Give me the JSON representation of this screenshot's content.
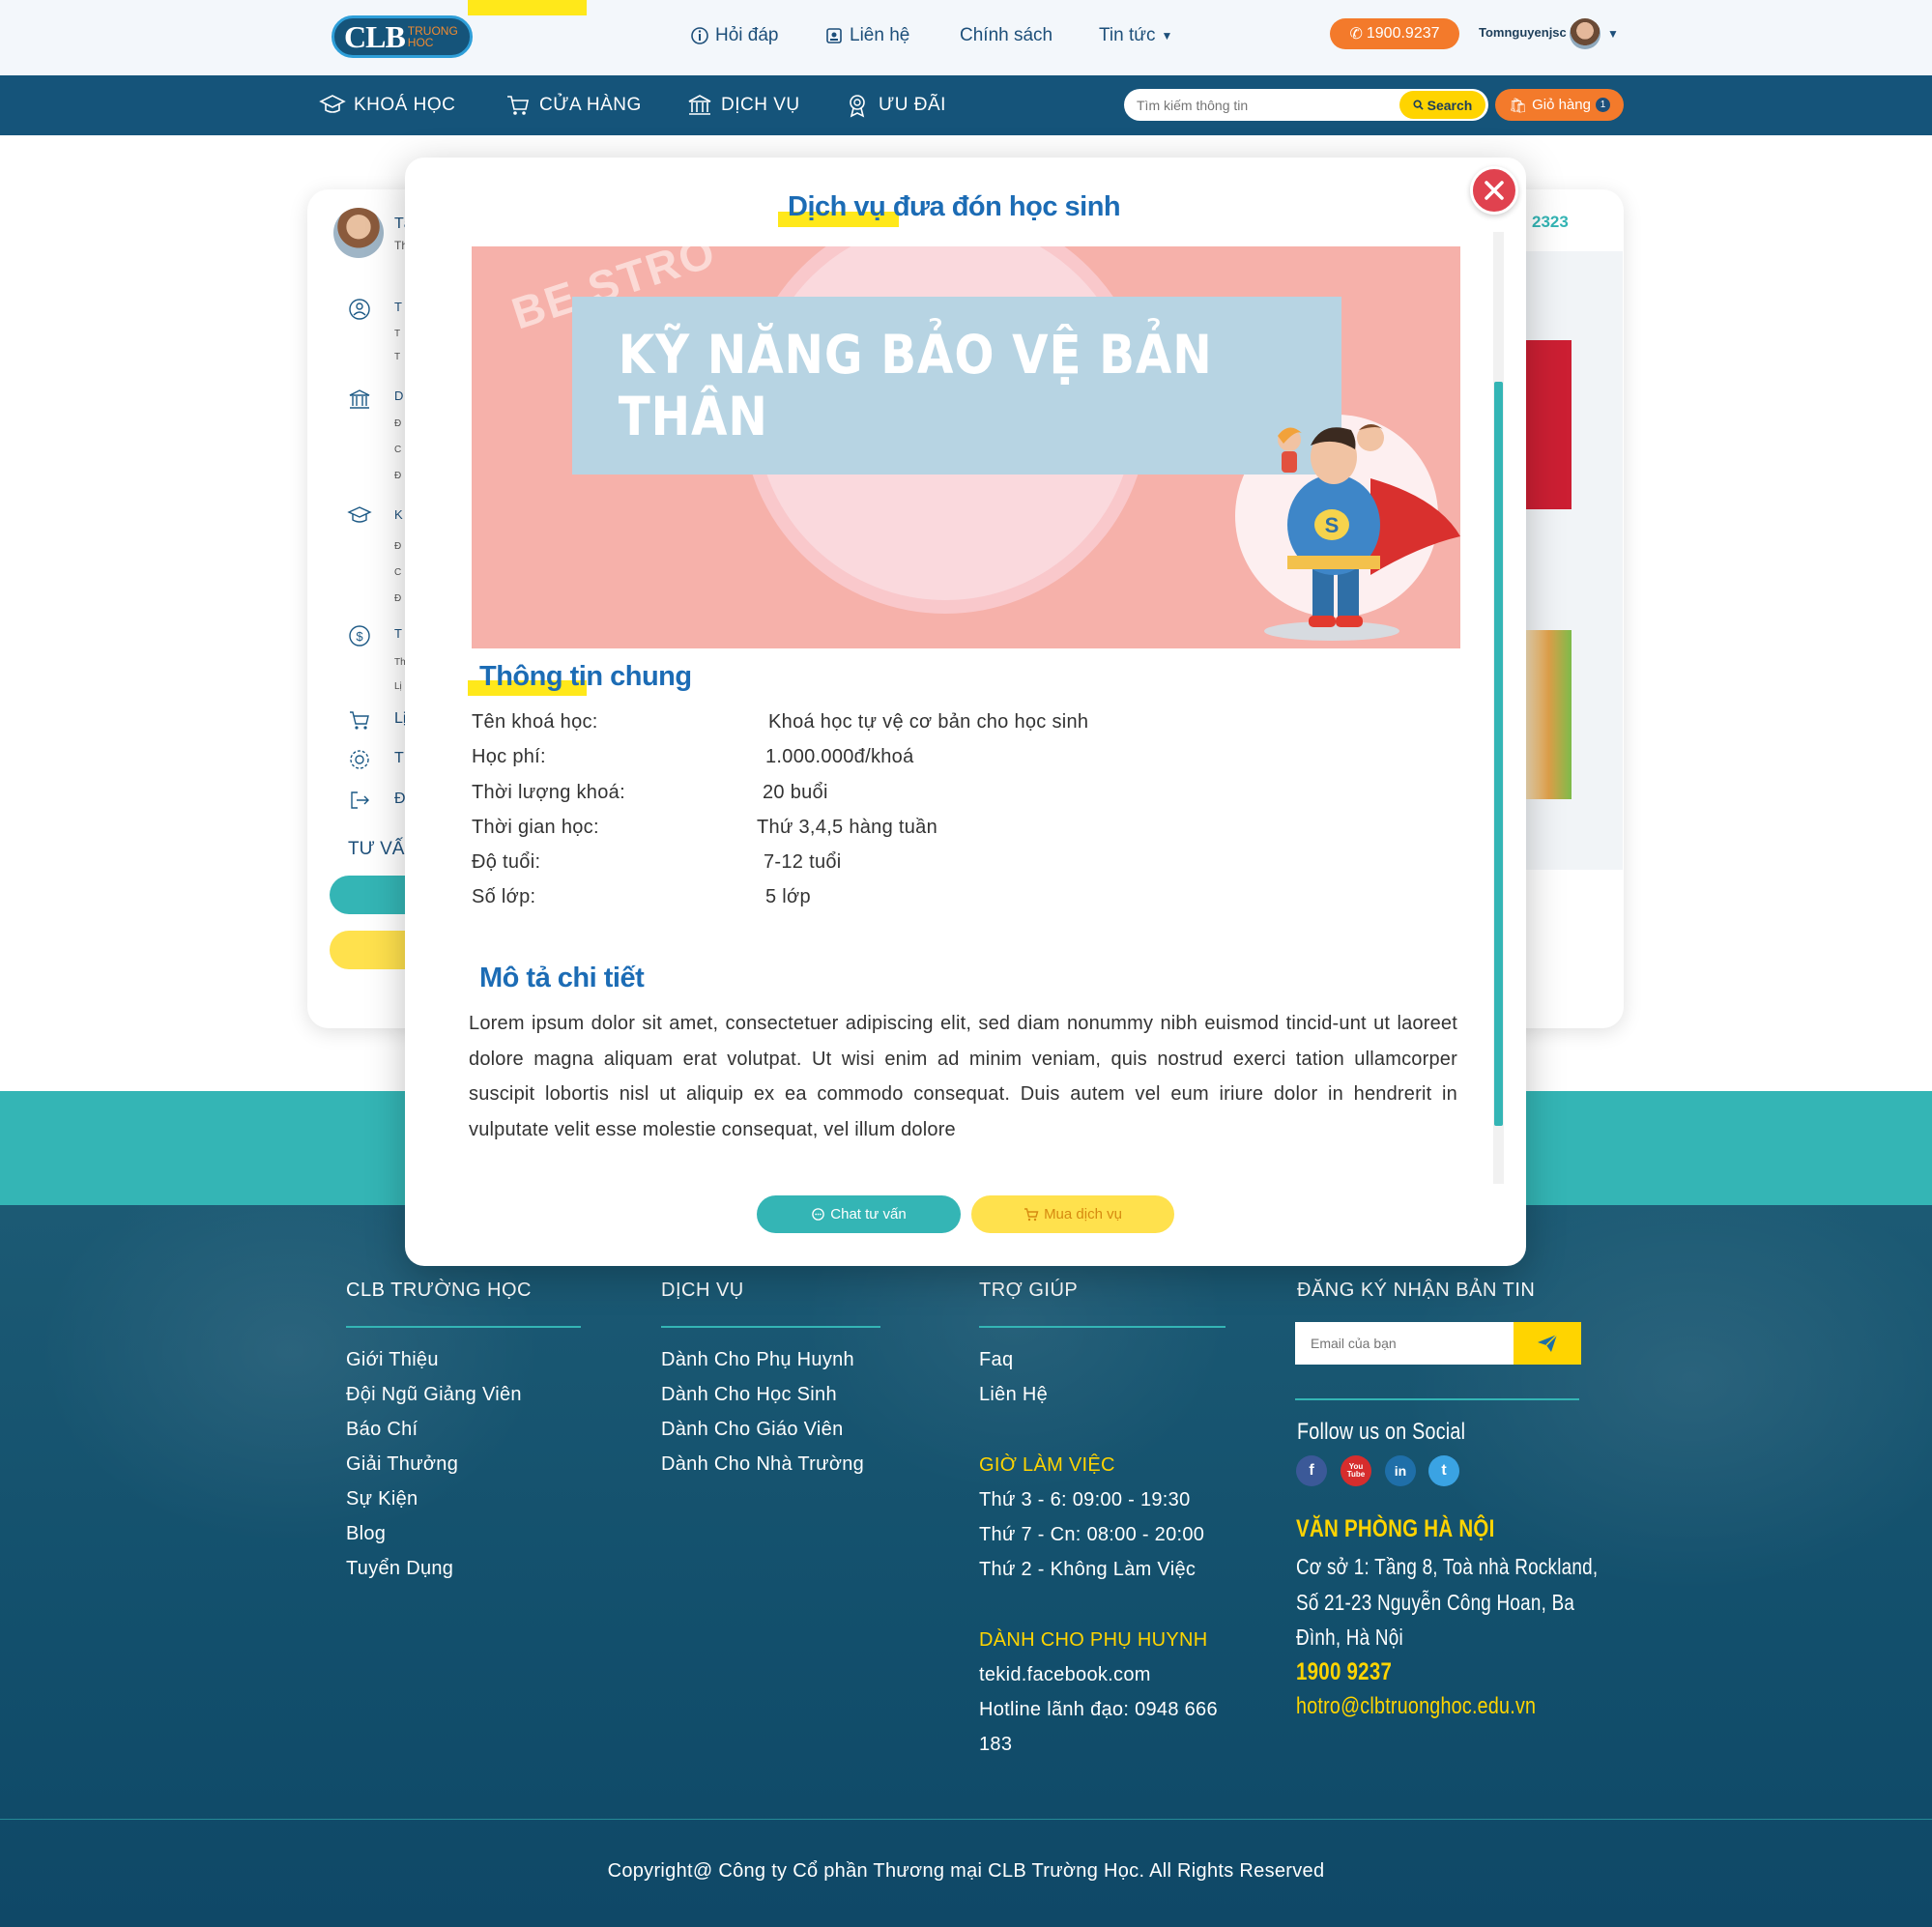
{
  "header": {
    "logo_big": "CLB",
    "logo_small_1": "TRUONG",
    "logo_small_2": "HOC",
    "top_links": [
      "Hỏi đáp",
      "Liên hệ",
      "Chính sách",
      "Tin tức"
    ],
    "phone": "1900.9237",
    "username": "Tomnguyenjsc"
  },
  "mainnav": {
    "items": [
      "KHOÁ HỌC",
      "CỬA HÀNG",
      "DỊCH VỤ",
      "ƯU ĐÃI"
    ],
    "search_placeholder": "Tìm kiếm thông tin",
    "search_label": "Search",
    "cart_label": "Giỏ hàng",
    "cart_count": "1"
  },
  "background": {
    "side_tuvan": "TƯ VẤ",
    "right_number": "2323",
    "side_letters": [
      "Tà",
      "Th",
      "T",
      "T",
      "D",
      "Đ",
      "C",
      "Đ",
      "K",
      "Đ",
      "C",
      "Đ",
      "T",
      "Th",
      "Lị",
      "Lị",
      "T",
      "Đ"
    ]
  },
  "modal": {
    "title_part1": "Dịch vụ",
    "title_part2": "đưa đón học sinh",
    "banner_text_be": "BE STRO",
    "banner_title": "KỸ NĂNG BẢO VỆ BẢN THÂN",
    "section1_title": "Thông tin chung",
    "info": [
      {
        "label": "Tên khoá học:",
        "value": "Khoá học tự vệ cơ bản cho học sinh"
      },
      {
        "label": "Học phí:",
        "value": "1.000.000đ/khoá"
      },
      {
        "label": "Thời lượng khoá:",
        "value": "20 buổi"
      },
      {
        "label": "Thời gian học:",
        "value": "Thứ 3,4,5 hàng tuần"
      },
      {
        "label": "Độ tuổi:",
        "value": "7-12 tuổi"
      },
      {
        "label": "Số lớp:",
        "value": "5 lớp"
      }
    ],
    "section2_title": "Mô tả chi tiết",
    "description": "Lorem ipsum dolor sit amet, consectetuer adipiscing elit, sed diam nonummy nibh euismod tincid-unt ut laoreet dolore magna aliquam erat volutpat. Ut wisi enim ad minim veniam, quis nostrud exerci tation ullamcorper suscipit lobortis nisl ut aliquip ex ea commodo consequat. Duis autem vel eum iriure dolor in hendrerit in vulputate velit esse molestie consequat, vel illum dolore",
    "chat_label": "Chat tư vấn",
    "buy_label": "Mua dịch vụ"
  },
  "footer": {
    "col1_title": "CLB TRƯỜNG HỌC",
    "col1_links": [
      "Giới Thiệu",
      "Đội Ngũ Giảng Viên",
      "Báo Chí",
      "Giải Thưởng",
      "Sự Kiện",
      "Blog",
      "Tuyển Dụng"
    ],
    "col2_title": "DỊCH VỤ",
    "col2_links": [
      "Dành Cho Phụ Huynh",
      "Dành Cho Học Sinh",
      "Dành Cho Giáo Viên",
      "Dành Cho Nhà Trường"
    ],
    "col3_title": "TRỢ GIÚP",
    "col3_links": [
      "Faq",
      "Liên Hệ"
    ],
    "hours_title": "GIỜ LÀM VIỆC",
    "hours": [
      "Thứ 3 - 6: 09:00 - 19:30",
      "Thứ 7 - Cn: 08:00 - 20:00",
      "Thứ 2 - Không Làm Việc"
    ],
    "parents_title": "DÀNH CHO PHỤ HUYNH",
    "parents_lines": [
      "tekid.facebook.com",
      "Hotline lãnh đạo: 0948 666",
      "183"
    ],
    "col4_title": "ĐĂNG KÝ NHẬN BẢN TIN",
    "email_placeholder": "Email của bạn",
    "follow": "Follow us on Social",
    "social": [
      "f",
      "You Tube",
      "in",
      "t"
    ],
    "office_title": "VĂN PHÒNG HÀ NỘI",
    "office_lines": [
      "Cơ sở 1: Tầng 8, Toà nhà Rockland,",
      "Số 21-23 Nguyễn Công Hoan, Ba",
      "Đình, Hà Nội"
    ],
    "office_phone": "1900 9237",
    "office_email": "hotro@clbtruonghoc.edu.vn",
    "copyright": "Copyright@ Công ty Cổ phần Thương mại CLB Trường Học. All Rights Reserved"
  },
  "colors": {
    "navy": "#15547a",
    "teal": "#34b5b5",
    "orange": "#f37a2b",
    "yellow": "#ffd400",
    "heading_blue": "#1c6cb5",
    "close_red": "#e0424f"
  }
}
